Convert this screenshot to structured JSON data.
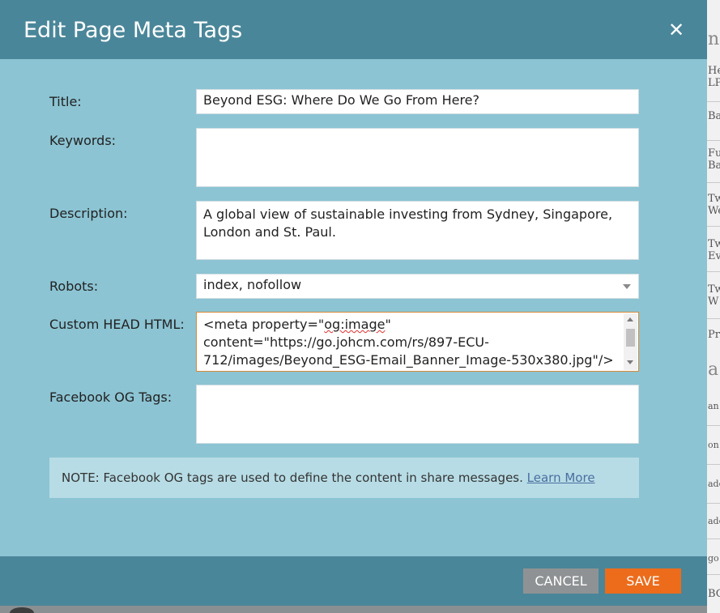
{
  "dialog": {
    "title": "Edit Page Meta Tags",
    "close_symbol": "✕"
  },
  "form": {
    "title_label": "Title:",
    "title_value": "Beyond ESG: Where Do We Go From Here?",
    "keywords_label": "Keywords:",
    "keywords_value": "",
    "description_label": "Description:",
    "description_value": "A global view of sustainable investing from Sydney, Singapore, London and St. Paul.",
    "robots_label": "Robots:",
    "robots_value": "index, nofollow",
    "custom_head_label": "Custom HEAD HTML:",
    "custom_head_value": {
      "part1": "<meta property=\"",
      "part2": "og:image",
      "part3": "\" content=\"https://go.johcm.com/rs/897-ECU-712/images/Beyond_ESG-Email_Banner_Image-530x380.jpg\"/>"
    },
    "facebook_og_label": "Facebook OG Tags:",
    "facebook_og_value": ""
  },
  "note": {
    "text": "NOTE: Facebook OG tags are used to define the content in share messages.",
    "link": "Learn More"
  },
  "footer": {
    "cancel_label": "CANCEL",
    "save_label": "SAVE"
  },
  "background_page": {
    "rows": [
      "nd",
      "He LP",
      "Ba",
      "Fu Ba",
      "Tw We",
      "Tw Ev",
      "Tw W",
      "Pr",
      "a",
      "an",
      "on",
      "ade",
      "ade",
      "go",
      "BG"
    ]
  },
  "colors": {
    "header": "#4a8699",
    "body": "#8cc4d3",
    "note_bg": "#b7dce5",
    "save": "#ec6c1c",
    "cancel": "#8f9294"
  }
}
